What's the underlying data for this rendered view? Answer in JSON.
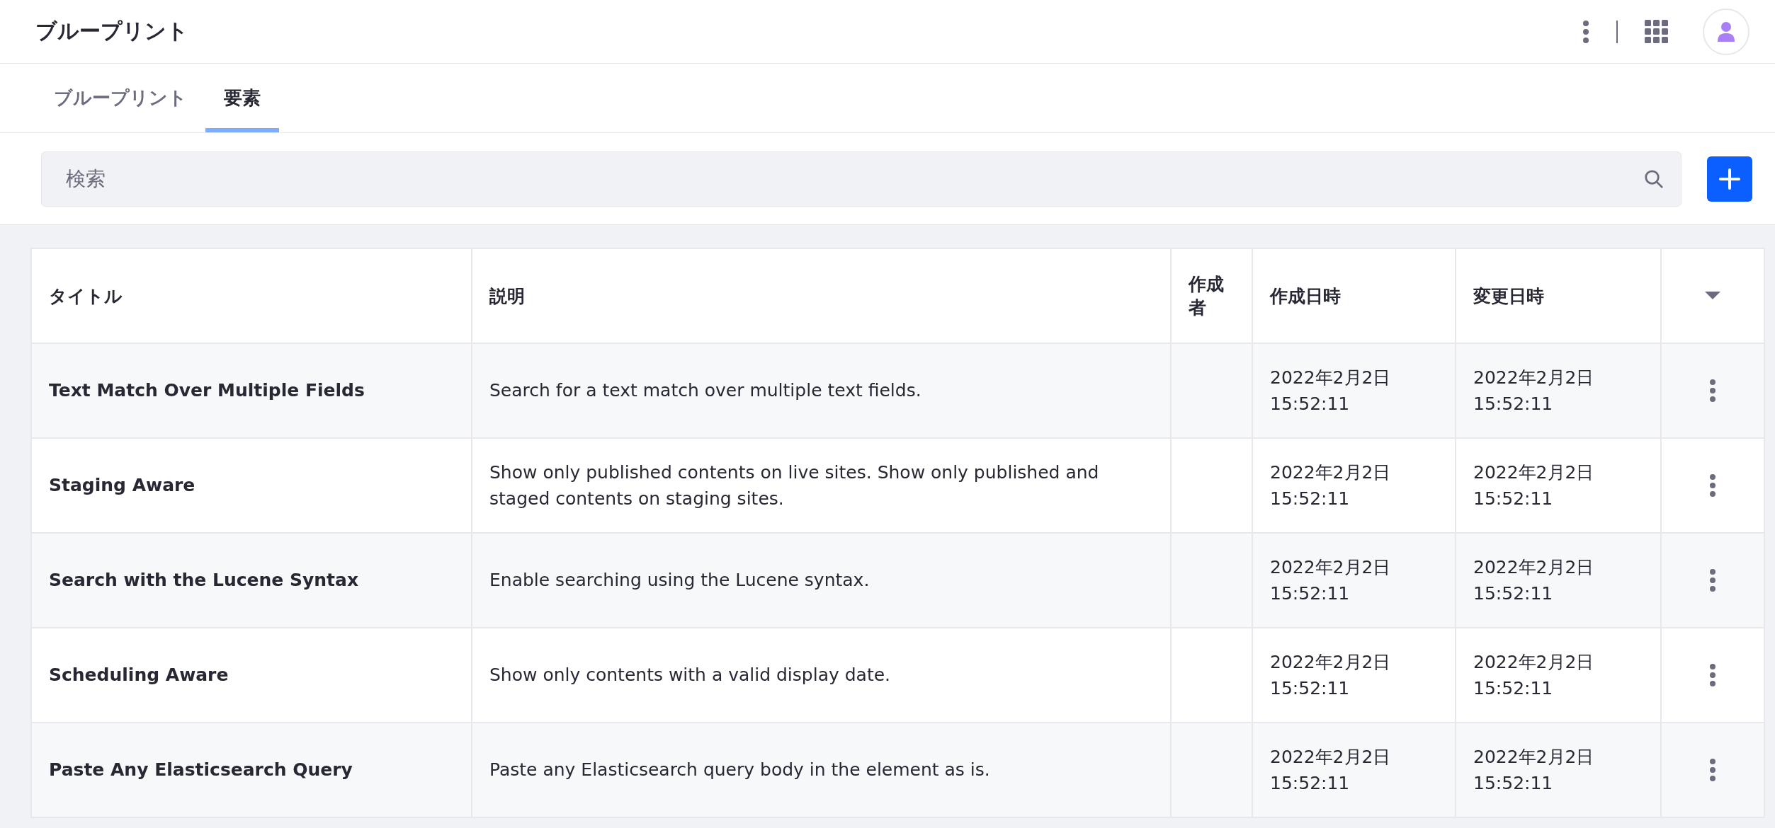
{
  "header": {
    "title": "ブループリント"
  },
  "tabs": [
    {
      "label": "ブループリント",
      "selected": false
    },
    {
      "label": "要素",
      "selected": true
    }
  ],
  "search": {
    "placeholder": "検索"
  },
  "table": {
    "columns": [
      "タイトル",
      "説明",
      "作成者",
      "作成日時",
      "変更日時"
    ],
    "rows": [
      {
        "title": "Text Match Over Multiple Fields",
        "description": "Search for a text match over multiple text fields.",
        "created": "2022年2月2日\n15:52:11",
        "modified": "2022年2月2日\n15:52:11"
      },
      {
        "title": "Staging Aware",
        "description": "Show only published contents on live sites. Show only published and staged contents on staging sites.",
        "created": "2022年2月2日\n15:52:11",
        "modified": "2022年2月2日\n15:52:11"
      },
      {
        "title": "Search with the Lucene Syntax",
        "description": "Enable searching using the Lucene syntax.",
        "created": "2022年2月2日\n15:52:11",
        "modified": "2022年2月2日\n15:52:11"
      },
      {
        "title": "Scheduling Aware",
        "description": "Show only contents with a valid display date.",
        "created": "2022年2月2日\n15:52:11",
        "modified": "2022年2月2日\n15:52:11"
      },
      {
        "title": "Paste Any Elasticsearch Query",
        "description": "Paste any Elasticsearch query body in the element as is.",
        "created": "2022年2月2日\n15:52:11",
        "modified": "2022年2月2日\n15:52:11"
      }
    ]
  }
}
